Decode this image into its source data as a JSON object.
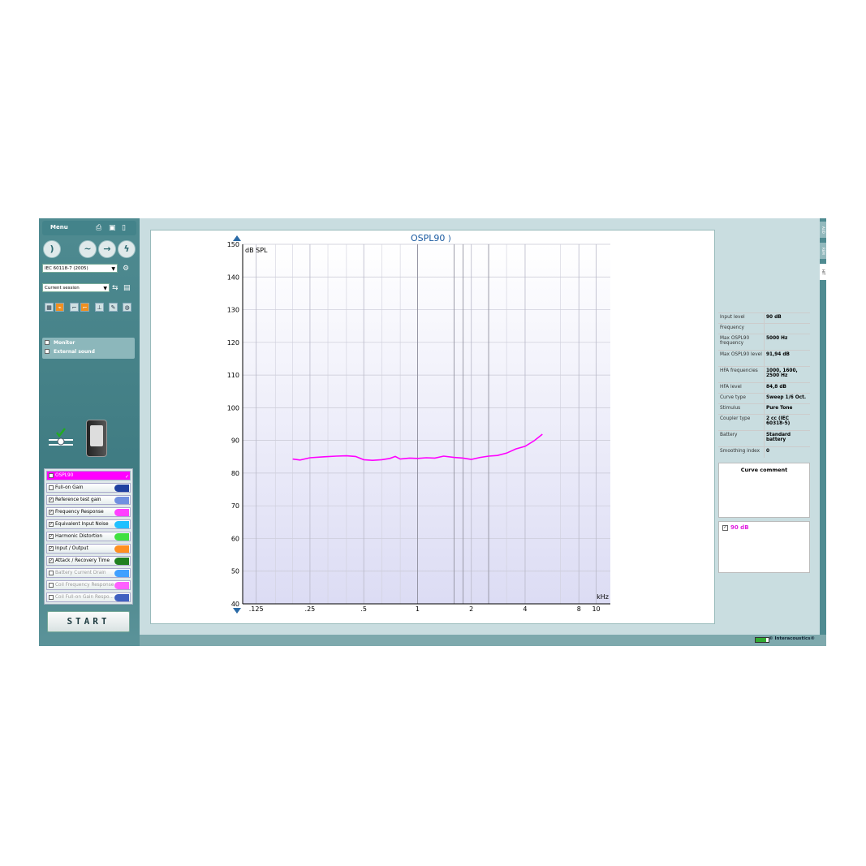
{
  "left_panel": {
    "menu_label": "Menu",
    "standard_select": "IEC 60118-7  (2005)",
    "session_select": "Current session",
    "monitor_label": "Monitor",
    "external_sound_label": "External sound",
    "start_label": "START",
    "tests": [
      {
        "label": "OSPL90",
        "checked": false,
        "selected": true,
        "enabled": true,
        "color": "#ff00ff"
      },
      {
        "label": "Full-on Gain",
        "checked": false,
        "selected": false,
        "enabled": true,
        "color": "#2040a0"
      },
      {
        "label": "Reference test gain",
        "checked": true,
        "selected": false,
        "enabled": true,
        "color": "#7090e0"
      },
      {
        "label": "Frequency Response",
        "checked": true,
        "selected": false,
        "enabled": true,
        "color": "#ff40ff"
      },
      {
        "label": "Equivalent Input Noise",
        "checked": true,
        "selected": false,
        "enabled": true,
        "color": "#20c0ff"
      },
      {
        "label": "Harmonic Distortion",
        "checked": true,
        "selected": false,
        "enabled": true,
        "color": "#40e040"
      },
      {
        "label": "Input / Output",
        "checked": true,
        "selected": false,
        "enabled": true,
        "color": "#ff9020"
      },
      {
        "label": "Attack / Recovery Time",
        "checked": true,
        "selected": false,
        "enabled": true,
        "color": "#208020"
      },
      {
        "label": "Battery Current Drain",
        "checked": false,
        "selected": false,
        "enabled": false,
        "color": "#40a0ff"
      },
      {
        "label": "Coil Frequency Response",
        "checked": false,
        "selected": false,
        "enabled": false,
        "color": "#ff60ff"
      },
      {
        "label": "Coil Full-on Gain Respo...",
        "checked": false,
        "selected": false,
        "enabled": false,
        "color": "#4060c0"
      }
    ]
  },
  "chart_data": {
    "type": "line",
    "title": "OSPL90",
    "ylabel": "dB SPL",
    "xlabel": "kHz",
    "x_scale": "log",
    "xlim": [
      0.105,
      12
    ],
    "ylim": [
      40,
      150
    ],
    "y_ticks": [
      40,
      50,
      60,
      70,
      80,
      90,
      100,
      110,
      120,
      130,
      140,
      150
    ],
    "x_ticks": [
      {
        "value": 0.125,
        "label": ".125"
      },
      {
        "value": 0.25,
        "label": ".25"
      },
      {
        "value": 0.5,
        "label": ".5"
      },
      {
        "value": 1,
        "label": "1"
      },
      {
        "value": 2,
        "label": "2"
      },
      {
        "value": 4,
        "label": "4"
      },
      {
        "value": 8,
        "label": "8"
      },
      {
        "value": 10,
        "label": "10"
      }
    ],
    "grid": true,
    "series": [
      {
        "name": "90 dB",
        "color": "#ff00ff",
        "x": [
          0.2,
          0.22,
          0.25,
          0.3,
          0.35,
          0.4,
          0.45,
          0.5,
          0.56,
          0.63,
          0.7,
          0.75,
          0.8,
          0.9,
          1.0,
          1.12,
          1.25,
          1.4,
          1.6,
          1.8,
          2.0,
          2.24,
          2.5,
          2.8,
          3.15,
          3.55,
          4.0,
          4.5,
          5.0
        ],
        "y": [
          84.3,
          84.0,
          84.7,
          85.0,
          85.2,
          85.3,
          85.1,
          84.1,
          83.9,
          84.1,
          84.5,
          85.1,
          84.3,
          84.6,
          84.5,
          84.7,
          84.6,
          85.2,
          84.8,
          84.6,
          84.2,
          84.8,
          85.2,
          85.4,
          86.1,
          87.4,
          88.2,
          89.9,
          91.9
        ]
      }
    ]
  },
  "info_table": [
    {
      "key": "Input level",
      "value": "90 dB"
    },
    {
      "key": "Frequency",
      "value": ""
    },
    {
      "key": "Max OSPL90 frequency",
      "value": "5000 Hz"
    },
    {
      "key": "Max OSPL90 level",
      "value": "91,94 dB"
    },
    {
      "key": "HFA frequencies",
      "value": "1000, 1600, 2500 Hz"
    },
    {
      "key": "HFA level",
      "value": "84,8 dB"
    },
    {
      "key": "Curve type",
      "value": "Sweep 1/6 Oct."
    },
    {
      "key": "Stimulus",
      "value": "Pure Tone"
    },
    {
      "key": "Coupler type",
      "value": "2 cc (IEC 60318-5)"
    },
    {
      "key": "Battery",
      "value": "Standard battery"
    },
    {
      "key": "Smoothing index",
      "value": "0"
    }
  ],
  "curve_comment_title": "Curve comment",
  "legend_label": "90 dB",
  "side_tabs": [
    "AUD",
    "REM",
    "HIT"
  ],
  "brand": "© Interacoustics®"
}
